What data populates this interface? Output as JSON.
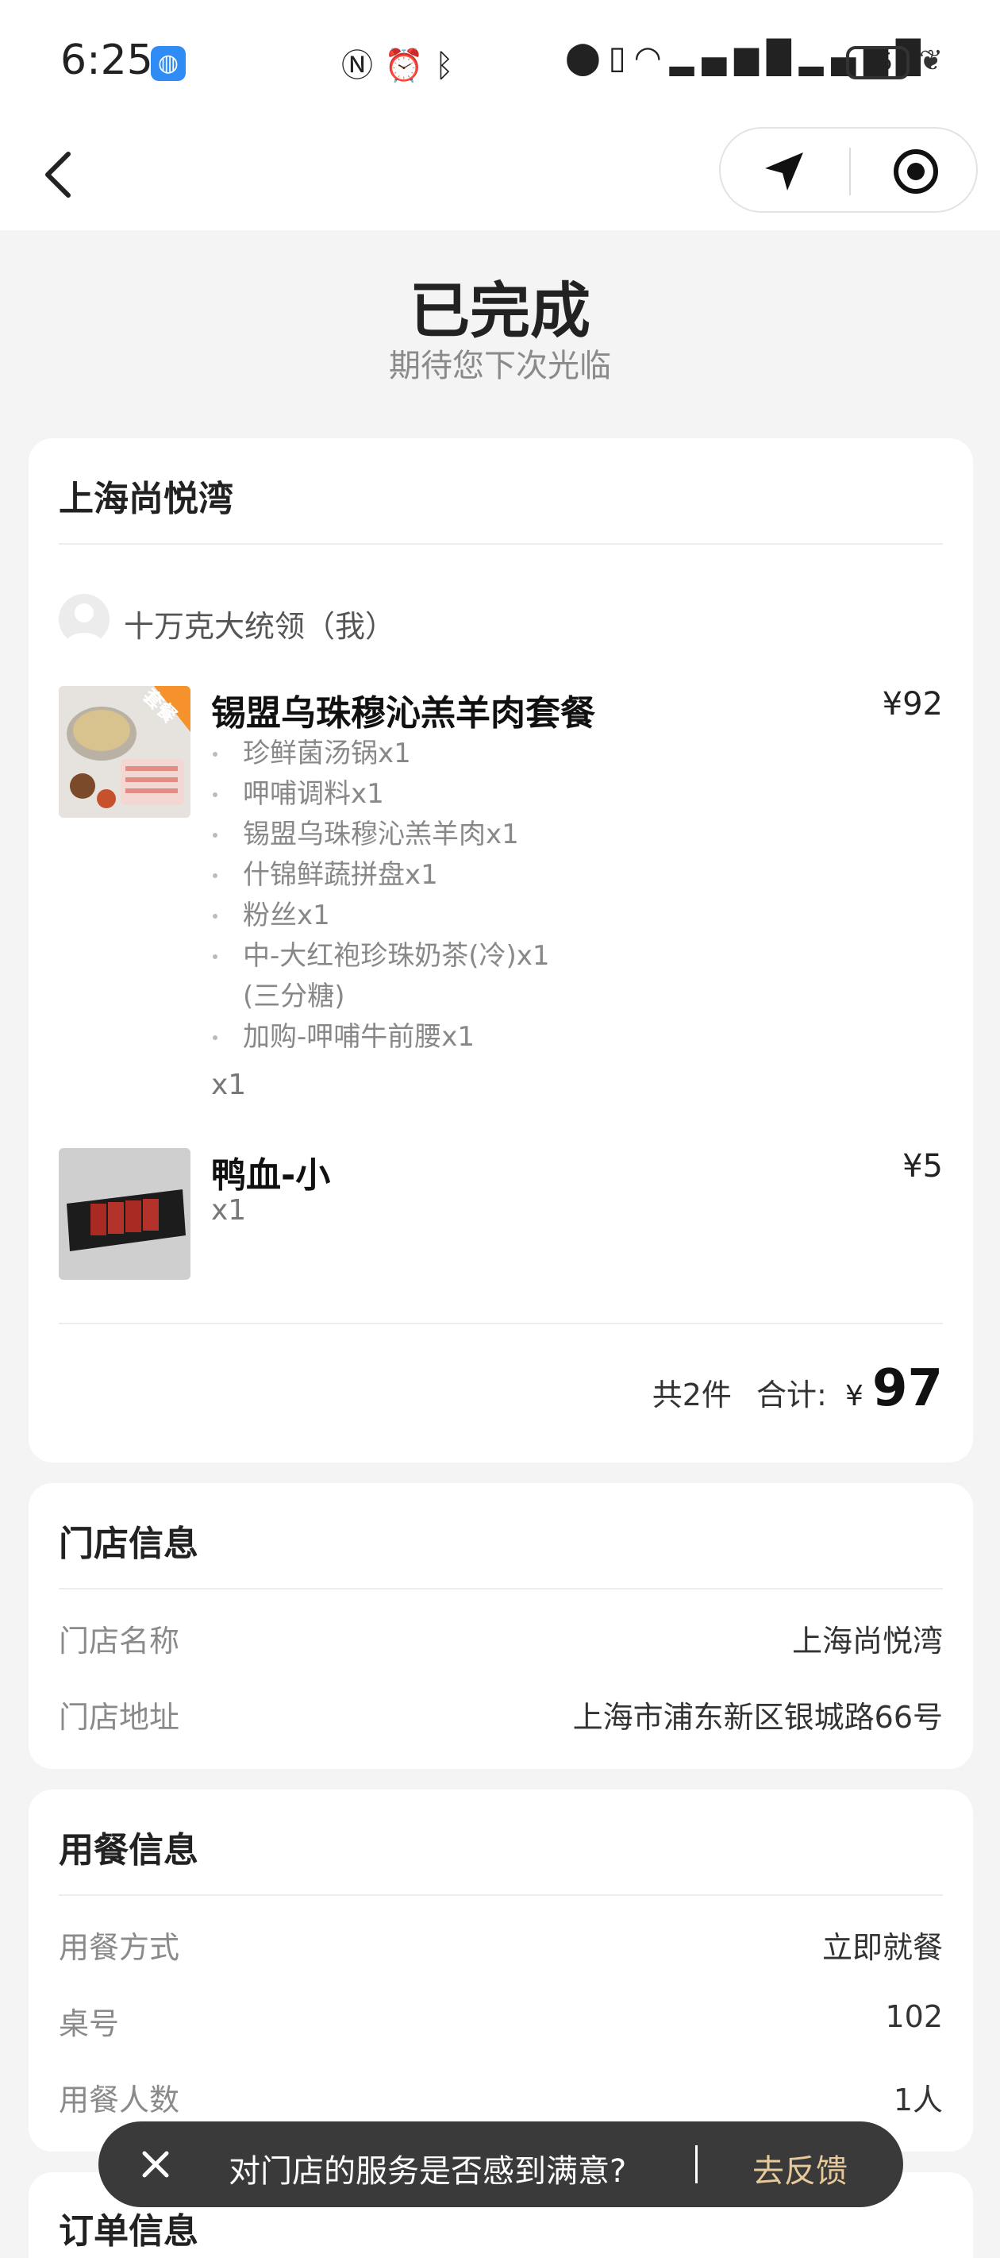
{
  "status_bar": {
    "time": "6:25",
    "globe_icon": "globe-icon",
    "middle_icons": [
      "nfc-icon",
      "alarm-icon",
      "bluetooth-icon"
    ],
    "right_icons": [
      "location-icon",
      "vibrate-icon",
      "wifi-icon",
      "signal-icon",
      "signal-icon"
    ],
    "battery": "65"
  },
  "nav": {
    "back_icon": "chevron-left-icon",
    "capsule_left_icon": "navigation-arrow-icon",
    "capsule_right_icon": "record-circle-icon"
  },
  "header": {
    "title": "已完成",
    "subtitle": "期待您下次光临"
  },
  "order_card": {
    "store_name": "上海尚悦湾",
    "user_name": "十万克大统领（我）",
    "items": [
      {
        "name": "锡盟乌珠穆沁羔羊肉套餐",
        "price": "¥92",
        "badge": "套餐",
        "sub_items": [
          "珍鲜菌汤锅x1",
          "呷哺调料x1",
          "锡盟乌珠穆沁羔羊肉x1",
          "什锦鲜蔬拼盘x1",
          "粉丝x1",
          "中-大红袍珍珠奶茶(冷)x1",
          "(三分糖)",
          "加购-呷哺牛前腰x1"
        ],
        "qty": "x1"
      },
      {
        "name": "鸭血-小",
        "price": "¥5",
        "qty": "x1"
      }
    ],
    "total_count": "共2件",
    "total_label": "合计:",
    "currency": "¥",
    "total_amount": "97"
  },
  "store_info": {
    "title": "门店信息",
    "rows": [
      {
        "label": "门店名称",
        "value": "上海尚悦湾"
      },
      {
        "label": "门店地址",
        "value": "上海市浦东新区银城路66号"
      }
    ]
  },
  "dining_info": {
    "title": "用餐信息",
    "rows": [
      {
        "label": "用餐方式",
        "value": "立即就餐"
      },
      {
        "label": "桌号",
        "value": "102"
      },
      {
        "label": "用餐人数",
        "value": "1人"
      }
    ]
  },
  "order_info": {
    "title": "订单信息"
  },
  "feedback_toast": {
    "question": "对门店的服务是否感到满意?",
    "link": "去反馈"
  },
  "colors": {
    "background": "#f4f4f4",
    "card": "#ffffff",
    "toast_bg": "#3a3a3a",
    "toast_link": "#e8c99a",
    "badge": "#f5922b"
  }
}
